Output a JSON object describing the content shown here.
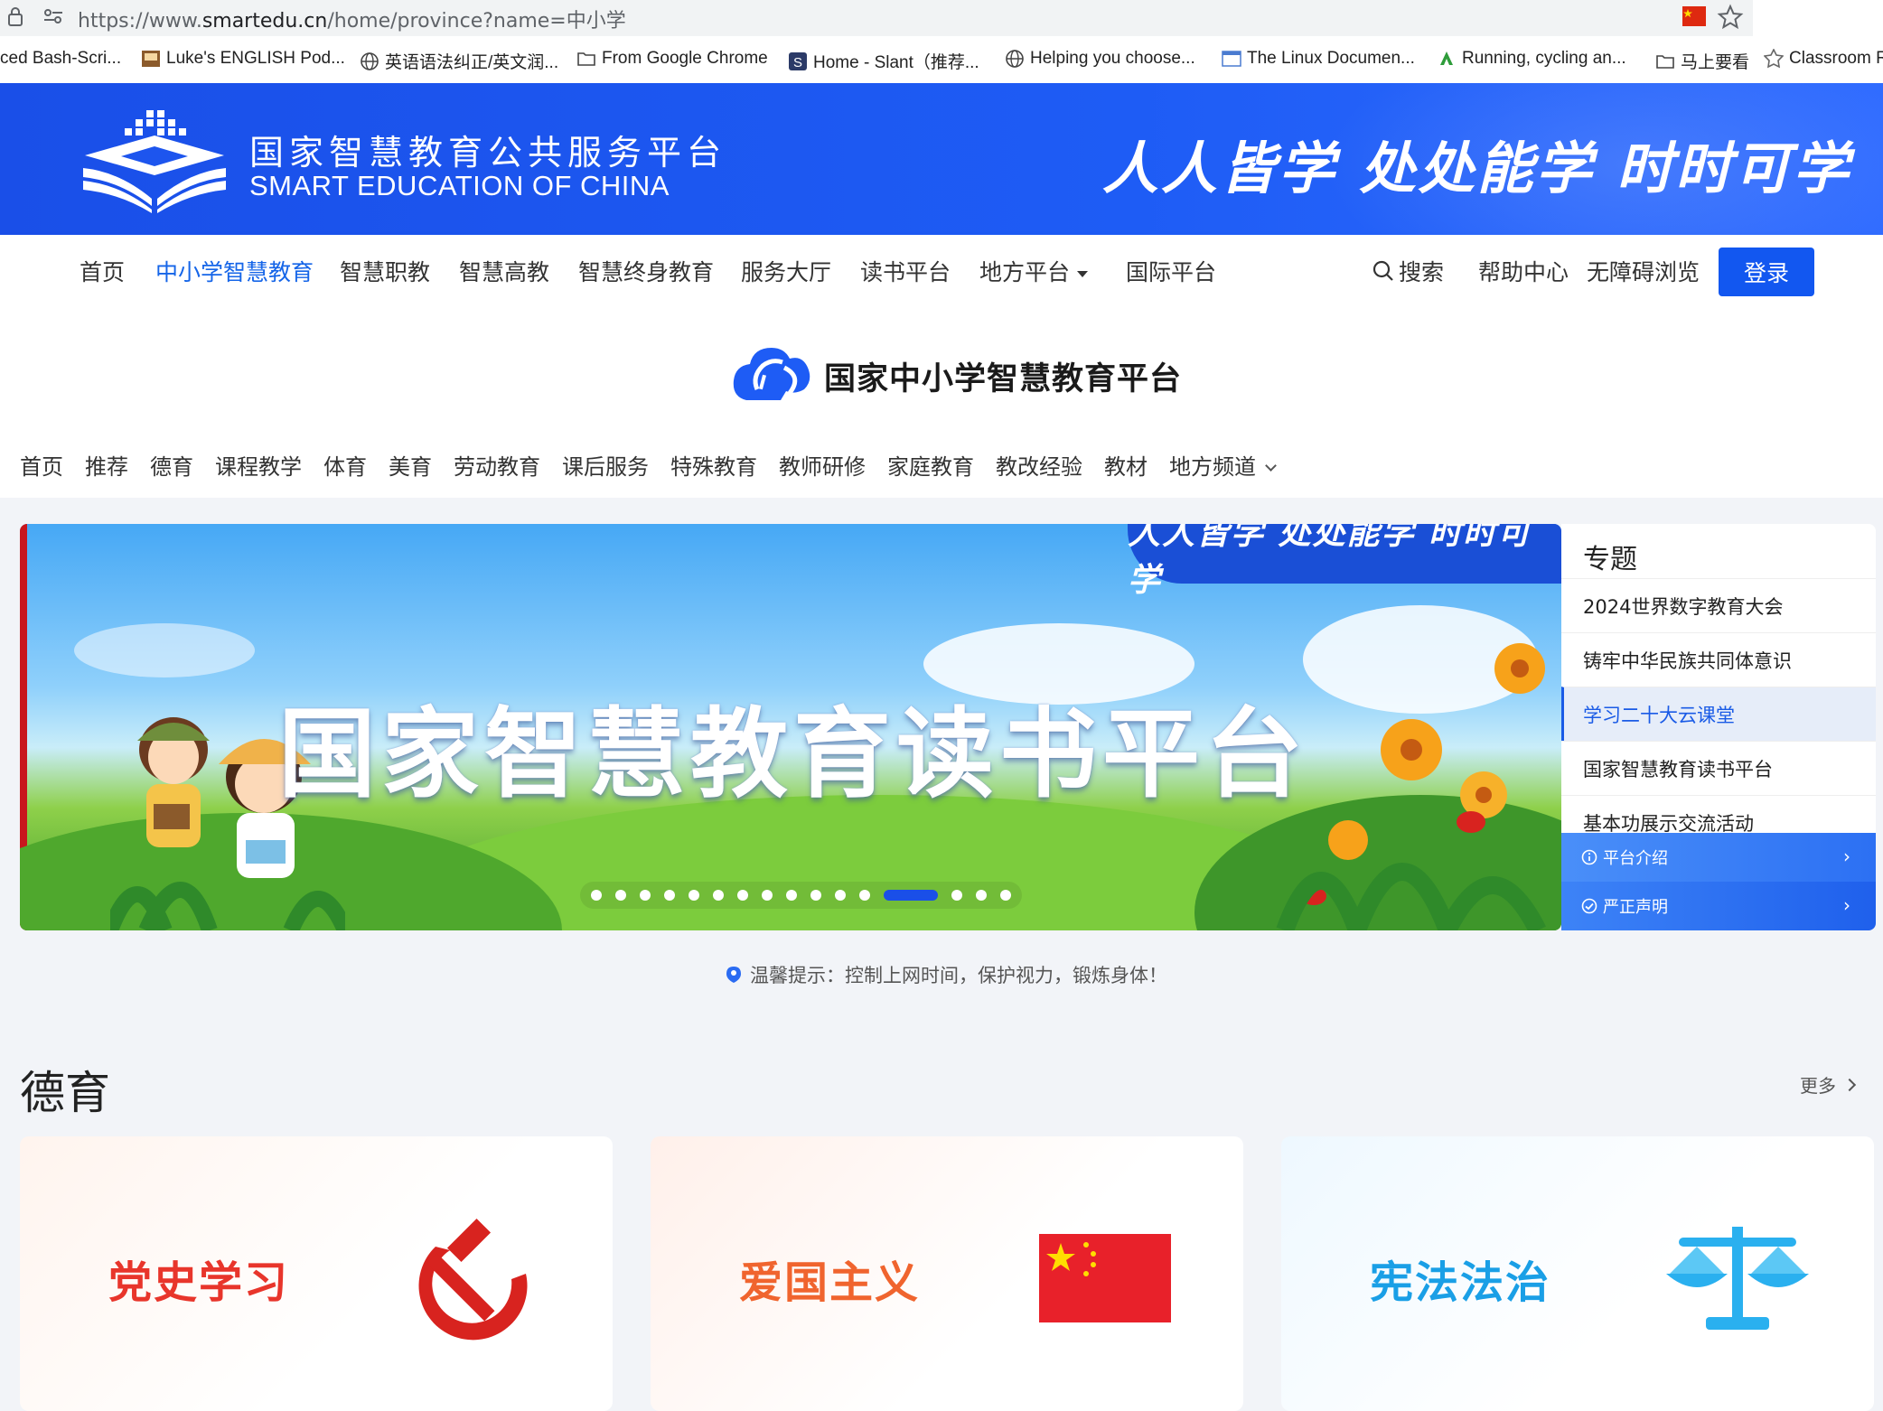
{
  "browser": {
    "url_prefix": "https://www.",
    "url_host": "smartedu.cn",
    "url_path": "/home/province?name=中小学",
    "bookmarks": [
      {
        "label": "ced Bash-Scri...",
        "icon": "none"
      },
      {
        "label": "Luke's ENGLISH Pod...",
        "icon": "podcast-icon"
      },
      {
        "label": "英语语法纠正/英文润...",
        "icon": "globe-icon"
      },
      {
        "label": "From Google Chrome",
        "icon": "folder-icon"
      },
      {
        "label": "Home - Slant（推荐...",
        "icon": "slant-icon"
      },
      {
        "label": "Helping you choose...",
        "icon": "globe-icon"
      },
      {
        "label": "The Linux Documen...",
        "icon": "tldp-icon"
      },
      {
        "label": "Running, cycling an...",
        "icon": "strava-icon"
      },
      {
        "label": "马上要看",
        "icon": "folder-icon"
      },
      {
        "label": "Classroom R",
        "icon": "classroom-icon"
      }
    ]
  },
  "header": {
    "title_cn": "国家智慧教育公共服务平台",
    "title_en": "SMART EDUCATION OF CHINA",
    "slogan": "人人皆学 处处能学 时时可学"
  },
  "mainnav": {
    "items": [
      "首页",
      "中小学智慧教育",
      "智慧职教",
      "智慧高教",
      "智慧终身教育",
      "服务大厅",
      "读书平台",
      "地方平台",
      "国际平台"
    ],
    "active_index": 1,
    "search": "搜索",
    "help": "帮助中心",
    "accessibility": "无障碍浏览",
    "login": "登录"
  },
  "platform": {
    "title": "国家中小学智慧教育平台",
    "subnav": [
      "首页",
      "推荐",
      "德育",
      "课程教学",
      "体育",
      "美育",
      "劳动教育",
      "课后服务",
      "特殊教育",
      "教师研修",
      "家庭教育",
      "教改经验",
      "教材",
      "地方频道"
    ]
  },
  "carousel": {
    "tag": "人人皆学 处处能学 时时可学",
    "headline": "国家智慧教育读书平台",
    "dot_count": 16,
    "active_dot": 12
  },
  "topics": {
    "heading": "专题",
    "items": [
      "2024世界数字教育大会",
      "铸牢中华民族共同体意识",
      "学习二十大云课堂",
      "国家智慧教育读书平台",
      "基本功展示交流活动"
    ],
    "highlighted_index": 2,
    "bottom_buttons": [
      "平台介绍",
      "严正声明"
    ]
  },
  "tip": "温馨提示：控制上网时间，保护视力，锻炼身体！",
  "section": {
    "title": "德育",
    "more": "更多",
    "cards": [
      {
        "title": "党史学习",
        "color": "#e8352b",
        "icon": "hammer-sickle-icon"
      },
      {
        "title": "爱国主义",
        "color": "#f0642e",
        "icon": "china-flag-icon"
      },
      {
        "title": "宪法法治",
        "color": "#1a9fe6",
        "icon": "scales-icon"
      }
    ]
  },
  "colors": {
    "brand_blue": "#1a4fe8",
    "active_link": "#1565e8",
    "login_bg": "#1257f0"
  }
}
